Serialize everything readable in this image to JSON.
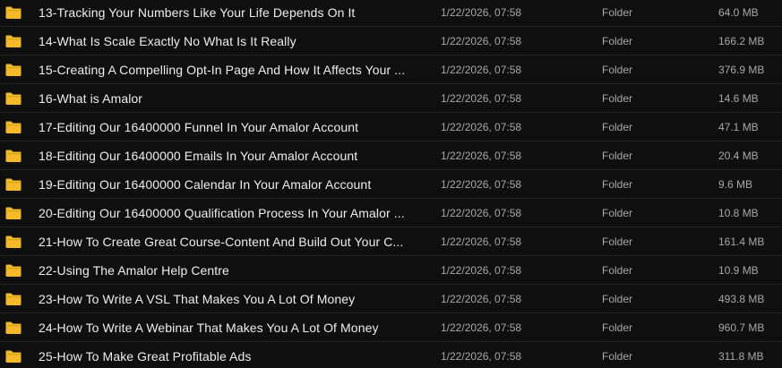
{
  "colors": {
    "background": "#0f0f0f",
    "folder_icon": "#f3b92a",
    "row_divider": "#262626",
    "name_text": "#ededed",
    "meta_text": "#a8a8a8"
  },
  "file_list": {
    "items": [
      {
        "icon": "folder-icon",
        "name": "13-Tracking Your Numbers Like Your Life Depends On It",
        "modified": "1/22/2026, 07:58",
        "type": "Folder",
        "size": "64.0 MB"
      },
      {
        "icon": "folder-icon",
        "name": "14-What Is Scale Exactly No What Is It Really",
        "modified": "1/22/2026, 07:58",
        "type": "Folder",
        "size": "166.2 MB"
      },
      {
        "icon": "folder-icon",
        "name": "15-Creating A Compelling Opt-In Page And How It Affects Your ...",
        "modified": "1/22/2026, 07:58",
        "type": "Folder",
        "size": "376.9 MB"
      },
      {
        "icon": "folder-icon",
        "name": "16-What is Amalor",
        "modified": "1/22/2026, 07:58",
        "type": "Folder",
        "size": "14.6 MB"
      },
      {
        "icon": "folder-icon",
        "name": "17-Editing Our 16400000 Funnel In Your Amalor Account",
        "modified": "1/22/2026, 07:58",
        "type": "Folder",
        "size": "47.1 MB"
      },
      {
        "icon": "folder-icon",
        "name": "18-Editing Our 16400000 Emails In Your Amalor Account",
        "modified": "1/22/2026, 07:58",
        "type": "Folder",
        "size": "20.4 MB"
      },
      {
        "icon": "folder-icon",
        "name": "19-Editing Our 16400000 Calendar In Your Amalor Account",
        "modified": "1/22/2026, 07:58",
        "type": "Folder",
        "size": "9.6 MB"
      },
      {
        "icon": "folder-icon",
        "name": "20-Editing Our 16400000 Qualification Process In Your Amalor ...",
        "modified": "1/22/2026, 07:58",
        "type": "Folder",
        "size": "10.8 MB"
      },
      {
        "icon": "folder-icon",
        "name": "21-How To Create Great Course-Content And Build Out Your C...",
        "modified": "1/22/2026, 07:58",
        "type": "Folder",
        "size": "161.4 MB"
      },
      {
        "icon": "folder-icon",
        "name": "22-Using The Amalor Help Centre",
        "modified": "1/22/2026, 07:58",
        "type": "Folder",
        "size": "10.9 MB"
      },
      {
        "icon": "folder-icon",
        "name": "23-How To Write A VSL That Makes You A Lot Of Money",
        "modified": "1/22/2026, 07:58",
        "type": "Folder",
        "size": "493.8 MB"
      },
      {
        "icon": "folder-icon",
        "name": "24-How To Write A Webinar That Makes You A Lot Of Money",
        "modified": "1/22/2026, 07:58",
        "type": "Folder",
        "size": "960.7 MB"
      },
      {
        "icon": "folder-icon",
        "name": "25-How To Make Great Profitable Ads",
        "modified": "1/22/2026, 07:58",
        "type": "Folder",
        "size": "311.8 MB"
      }
    ]
  }
}
